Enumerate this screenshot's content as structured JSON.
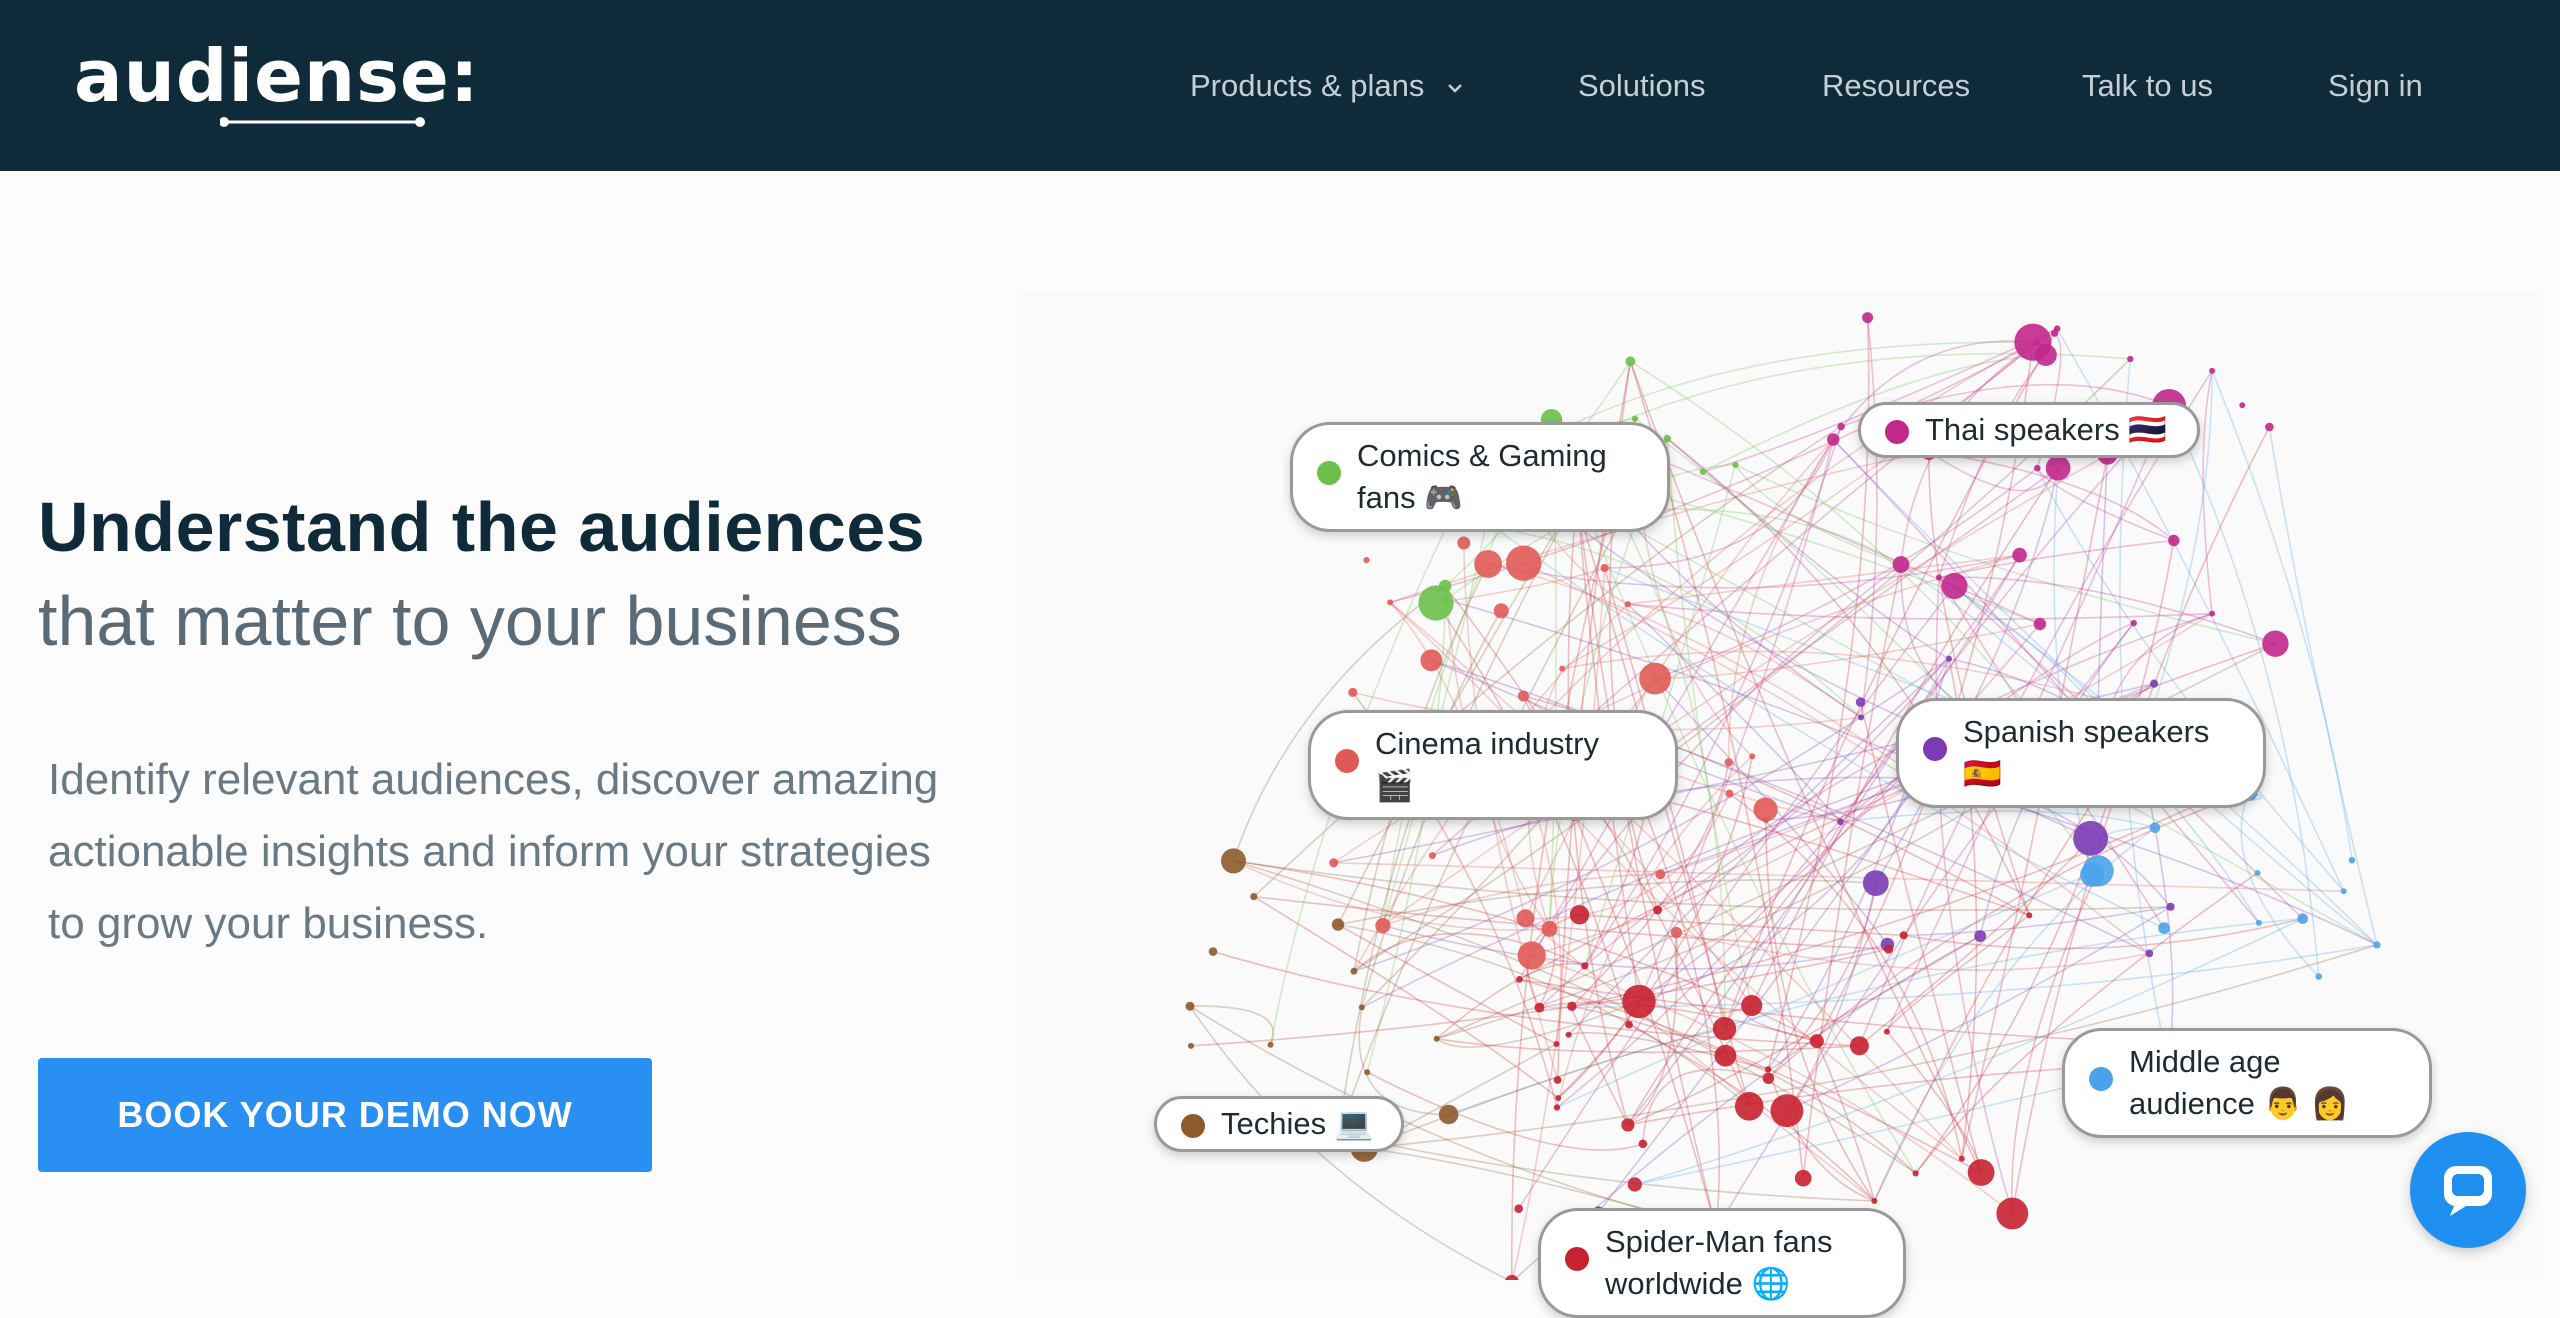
{
  "header": {
    "logo_text": "audiense:",
    "nav": [
      {
        "label": "Products & plans",
        "has_dropdown": true
      },
      {
        "label": "Solutions"
      },
      {
        "label": "Resources"
      },
      {
        "label": "Talk to us"
      },
      {
        "label": "Sign in"
      }
    ]
  },
  "hero": {
    "headline_bold": "Understand the audiences",
    "headline_light": "that matter to your business",
    "subtext_lines": [
      "Identify relevant audiences, discover amazing",
      "actionable insights and inform your strategies",
      "to grow your business."
    ],
    "cta_label": "BOOK YOUR DEMO NOW"
  },
  "graph": {
    "clusters": [
      {
        "label_lines": [
          "Comics & Gaming",
          "fans 🎮"
        ],
        "color": "#6cc04a"
      },
      {
        "label_lines": [
          "Thai speakers 🇹🇭"
        ],
        "color": "#c2278c"
      },
      {
        "label_lines": [
          "Cinema industry",
          "🎬"
        ],
        "color": "#e05a55"
      },
      {
        "label_lines": [
          "Spanish speakers",
          "🇪🇸"
        ],
        "color": "#7b3bb5"
      },
      {
        "label_lines": [
          "Middle age",
          "audience 👨 👩"
        ],
        "color": "#4aa3ea"
      },
      {
        "label_lines": [
          "Techies 💻"
        ],
        "color": "#8c5a2b"
      },
      {
        "label_lines": [
          "Spider-Man fans",
          "worldwide 🌐"
        ],
        "color": "#c8212f"
      }
    ]
  },
  "chat": {
    "icon": "chat-icon"
  }
}
